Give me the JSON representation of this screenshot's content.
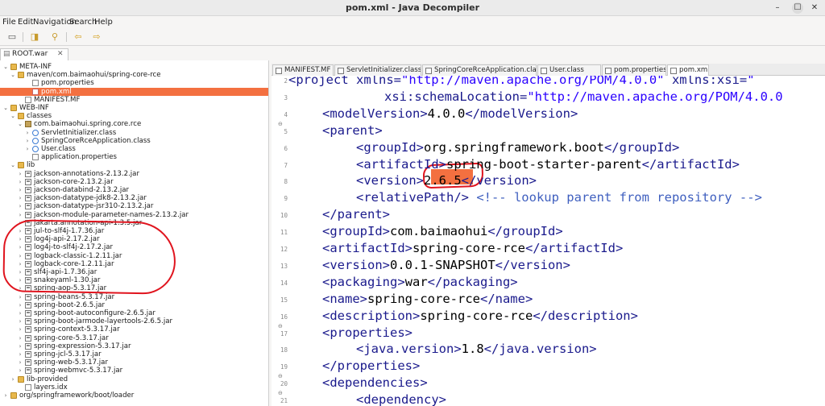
{
  "window": {
    "title": "pom.xml - Java Decompiler"
  },
  "menubar": {
    "items": [
      "File",
      "Edit",
      "Navigation",
      "Search",
      "Help"
    ]
  },
  "root_tab": {
    "label": "ROOT.war"
  },
  "tree": [
    {
      "label": "META-INF",
      "icon": "folder",
      "twisty": "v",
      "indent": 0
    },
    {
      "label": "maven/com.baimaohui/spring-core-rce",
      "icon": "folder",
      "twisty": "v",
      "indent": 1
    },
    {
      "label": "pom.properties",
      "icon": "file",
      "twisty": "",
      "indent": 3
    },
    {
      "label": "pom.xml",
      "icon": "xml",
      "twisty": "",
      "indent": 3,
      "selected": true
    },
    {
      "label": "MANIFEST.MF",
      "icon": "file",
      "twisty": "",
      "indent": 2
    },
    {
      "label": "WEB-INF",
      "icon": "folder",
      "twisty": "v",
      "indent": 0
    },
    {
      "label": "classes",
      "icon": "folder",
      "twisty": "v",
      "indent": 1
    },
    {
      "label": "com.baimaohui.spring.core.rce",
      "icon": "pkg",
      "twisty": "v",
      "indent": 2
    },
    {
      "label": "ServletInitializer.class",
      "icon": "class",
      "twisty": ">",
      "indent": 3
    },
    {
      "label": "SpringCoreRceApplication.class",
      "icon": "class",
      "twisty": ">",
      "indent": 3
    },
    {
      "label": "User.class",
      "icon": "class",
      "twisty": ">",
      "indent": 3
    },
    {
      "label": "application.properties",
      "icon": "file",
      "twisty": "",
      "indent": 3
    },
    {
      "label": "lib",
      "icon": "folder",
      "twisty": "v",
      "indent": 1
    },
    {
      "label": "jackson-annotations-2.13.2.jar",
      "icon": "jar",
      "twisty": ">",
      "indent": 2
    },
    {
      "label": "jackson-core-2.13.2.jar",
      "icon": "jar",
      "twisty": ">",
      "indent": 2
    },
    {
      "label": "jackson-databind-2.13.2.jar",
      "icon": "jar",
      "twisty": ">",
      "indent": 2
    },
    {
      "label": "jackson-datatype-jdk8-2.13.2.jar",
      "icon": "jar",
      "twisty": ">",
      "indent": 2
    },
    {
      "label": "jackson-datatype-jsr310-2.13.2.jar",
      "icon": "jar",
      "twisty": ">",
      "indent": 2
    },
    {
      "label": "jackson-module-parameter-names-2.13.2.jar",
      "icon": "jar",
      "twisty": ">",
      "indent": 2
    },
    {
      "label": "jakarta.annotation-api-1.3.5.jar",
      "icon": "jar",
      "twisty": ">",
      "indent": 2
    },
    {
      "label": "jul-to-slf4j-1.7.36.jar",
      "icon": "jar",
      "twisty": ">",
      "indent": 2
    },
    {
      "label": "log4j-api-2.17.2.jar",
      "icon": "jar",
      "twisty": ">",
      "indent": 2
    },
    {
      "label": "log4j-to-slf4j-2.17.2.jar",
      "icon": "jar",
      "twisty": ">",
      "indent": 2
    },
    {
      "label": "logback-classic-1.2.11.jar",
      "icon": "jar",
      "twisty": ">",
      "indent": 2
    },
    {
      "label": "logback-core-1.2.11.jar",
      "icon": "jar",
      "twisty": ">",
      "indent": 2
    },
    {
      "label": "slf4j-api-1.7.36.jar",
      "icon": "jar",
      "twisty": ">",
      "indent": 2
    },
    {
      "label": "snakeyaml-1.30.jar",
      "icon": "jar",
      "twisty": ">",
      "indent": 2
    },
    {
      "label": "spring-aop-5.3.17.jar",
      "icon": "jar",
      "twisty": ">",
      "indent": 2
    },
    {
      "label": "spring-beans-5.3.17.jar",
      "icon": "jar",
      "twisty": ">",
      "indent": 2
    },
    {
      "label": "spring-boot-2.6.5.jar",
      "icon": "jar",
      "twisty": ">",
      "indent": 2
    },
    {
      "label": "spring-boot-autoconfigure-2.6.5.jar",
      "icon": "jar",
      "twisty": ">",
      "indent": 2
    },
    {
      "label": "spring-boot-jarmode-layertools-2.6.5.jar",
      "icon": "jar",
      "twisty": ">",
      "indent": 2
    },
    {
      "label": "spring-context-5.3.17.jar",
      "icon": "jar",
      "twisty": ">",
      "indent": 2
    },
    {
      "label": "spring-core-5.3.17.jar",
      "icon": "jar",
      "twisty": ">",
      "indent": 2
    },
    {
      "label": "spring-expression-5.3.17.jar",
      "icon": "jar",
      "twisty": ">",
      "indent": 2
    },
    {
      "label": "spring-jcl-5.3.17.jar",
      "icon": "jar",
      "twisty": ">",
      "indent": 2
    },
    {
      "label": "spring-web-5.3.17.jar",
      "icon": "jar",
      "twisty": ">",
      "indent": 2
    },
    {
      "label": "spring-webmvc-5.3.17.jar",
      "icon": "jar",
      "twisty": ">",
      "indent": 2
    },
    {
      "label": "lib-provided",
      "icon": "folder",
      "twisty": ">",
      "indent": 1
    },
    {
      "label": "layers.idx",
      "icon": "file",
      "twisty": "",
      "indent": 2
    },
    {
      "label": "org/springframework/boot/loader",
      "icon": "folder",
      "twisty": ">",
      "indent": 0
    }
  ],
  "tabs": [
    "MANIFEST.MF",
    "ServletInitializer.class",
    "SpringCoreRceApplication.class",
    "User.class",
    "pom.properties",
    "pom.xml"
  ],
  "editor": {
    "lines": [
      {
        "n": "2",
        "fold": "",
        "indent": 0,
        "segs": [
          [
            "tag",
            "<project xmlns="
          ],
          [
            "str",
            "\"http://maven.apache.org/POM/4.0.0\""
          ],
          [
            "tag",
            " xmlns:xsi="
          ],
          [
            "str",
            "\""
          ]
        ]
      },
      {
        "n": "3",
        "fold": "",
        "indent": 5,
        "segs": [
          [
            "tag",
            "xsi:schemaLocation="
          ],
          [
            "str",
            "\"http://maven.apache.org/POM/4.0.0"
          ]
        ]
      },
      {
        "n": "4",
        "fold": "",
        "indent": 1,
        "segs": [
          [
            "tag",
            "<modelVersion>"
          ],
          [
            "txt",
            "4.0.0"
          ],
          [
            "tag",
            "</modelVersion>"
          ]
        ]
      },
      {
        "n": "5",
        "fold": "⊖",
        "indent": 1,
        "segs": [
          [
            "tag",
            "<parent>"
          ]
        ]
      },
      {
        "n": "6",
        "fold": "",
        "indent": 2,
        "segs": [
          [
            "tag",
            "<groupId>"
          ],
          [
            "txt",
            "org.springframework.boot"
          ],
          [
            "tag",
            "</groupId>"
          ]
        ]
      },
      {
        "n": "7",
        "fold": "",
        "indent": 2,
        "segs": [
          [
            "tag",
            "<artifactId>"
          ],
          [
            "txt",
            "spring-boot-starter-parent"
          ],
          [
            "tag",
            "</artifactId>"
          ]
        ]
      },
      {
        "n": "8",
        "fold": "",
        "indent": 2,
        "segs": [
          [
            "tag",
            "<version>"
          ],
          [
            "txt",
            "2.6.5"
          ],
          [
            "tag",
            "</version>"
          ]
        ]
      },
      {
        "n": "9",
        "fold": "",
        "indent": 2,
        "segs": [
          [
            "tag",
            "<relativePath/>"
          ],
          [
            "cmt",
            " <!-- lookup parent from repository -->"
          ]
        ]
      },
      {
        "n": "10",
        "fold": "",
        "indent": 1,
        "segs": [
          [
            "tag",
            "</parent>"
          ]
        ]
      },
      {
        "n": "11",
        "fold": "",
        "indent": 1,
        "segs": [
          [
            "tag",
            "<groupId>"
          ],
          [
            "txt",
            "com.baimaohui"
          ],
          [
            "tag",
            "</groupId>"
          ]
        ]
      },
      {
        "n": "12",
        "fold": "",
        "indent": 1,
        "segs": [
          [
            "tag",
            "<artifactId>"
          ],
          [
            "txt",
            "spring-core-rce"
          ],
          [
            "tag",
            "</artifactId>"
          ]
        ]
      },
      {
        "n": "13",
        "fold": "",
        "indent": 1,
        "segs": [
          [
            "tag",
            "<version>"
          ],
          [
            "txt",
            "0.0.1-SNAPSHOT"
          ],
          [
            "tag",
            "</version>"
          ]
        ]
      },
      {
        "n": "14",
        "fold": "",
        "indent": 1,
        "segs": [
          [
            "tag",
            "<packaging>"
          ],
          [
            "txt",
            "war"
          ],
          [
            "tag",
            "</packaging>"
          ]
        ]
      },
      {
        "n": "15",
        "fold": "",
        "indent": 1,
        "segs": [
          [
            "tag",
            "<name>"
          ],
          [
            "txt",
            "spring-core-rce"
          ],
          [
            "tag",
            "</name>"
          ]
        ]
      },
      {
        "n": "16",
        "fold": "",
        "indent": 1,
        "segs": [
          [
            "tag",
            "<description>"
          ],
          [
            "txt",
            "spring-core-rce"
          ],
          [
            "tag",
            "</description>"
          ]
        ]
      },
      {
        "n": "17",
        "fold": "⊖",
        "indent": 1,
        "segs": [
          [
            "tag",
            "<properties>"
          ]
        ]
      },
      {
        "n": "18",
        "fold": "",
        "indent": 2,
        "segs": [
          [
            "tag",
            "<java.version>"
          ],
          [
            "txt",
            "1.8"
          ],
          [
            "tag",
            "</java.version>"
          ]
        ]
      },
      {
        "n": "19",
        "fold": "",
        "indent": 1,
        "segs": [
          [
            "tag",
            "</properties>"
          ]
        ]
      },
      {
        "n": "20",
        "fold": "⊖",
        "indent": 1,
        "segs": [
          [
            "tag",
            "<dependencies>"
          ]
        ]
      },
      {
        "n": "21",
        "fold": "⊖",
        "indent": 2,
        "segs": [
          [
            "tag",
            "<dependency>"
          ]
        ]
      }
    ]
  }
}
